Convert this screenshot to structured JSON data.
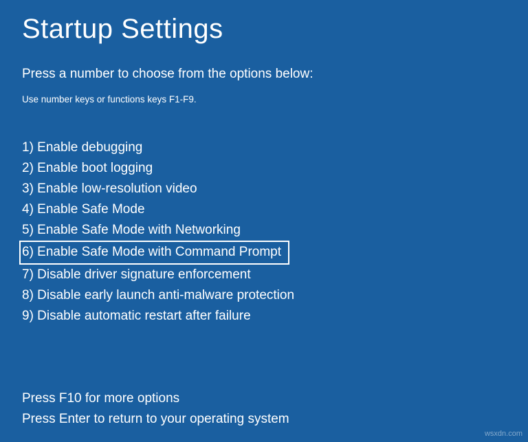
{
  "title": "Startup Settings",
  "subtitle": "Press a number to choose from the options below:",
  "hint": "Use number keys or functions keys F1-F9.",
  "options": [
    {
      "num": "1",
      "label": "Enable debugging",
      "highlighted": false
    },
    {
      "num": "2",
      "label": "Enable boot logging",
      "highlighted": false
    },
    {
      "num": "3",
      "label": "Enable low-resolution video",
      "highlighted": false
    },
    {
      "num": "4",
      "label": "Enable Safe Mode",
      "highlighted": false
    },
    {
      "num": "5",
      "label": "Enable Safe Mode with Networking",
      "highlighted": false
    },
    {
      "num": "6",
      "label": "Enable Safe Mode with Command Prompt",
      "highlighted": true
    },
    {
      "num": "7",
      "label": "Disable driver signature enforcement",
      "highlighted": false
    },
    {
      "num": "8",
      "label": "Disable early launch anti-malware protection",
      "highlighted": false
    },
    {
      "num": "9",
      "label": "Disable automatic restart after failure",
      "highlighted": false
    }
  ],
  "footer_more": "Press F10 for more options",
  "footer_return": "Press Enter to return to your operating system",
  "watermark": "wsxdn.com"
}
